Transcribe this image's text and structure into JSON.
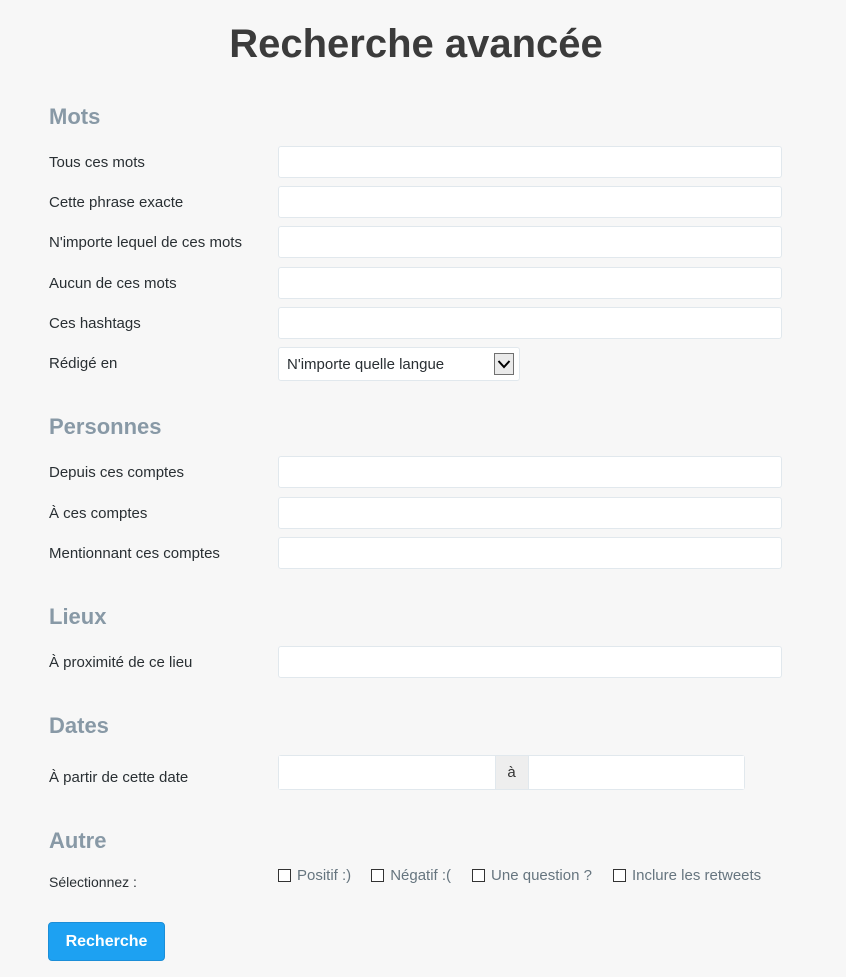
{
  "page": {
    "title": "Recherche avancée"
  },
  "words": {
    "heading": "Mots",
    "all_label": "Tous ces mots",
    "exact_label": "Cette phrase exacte",
    "any_label": "N'importe lequel de ces mots",
    "none_label": "Aucun de ces mots",
    "hashtags_label": "Ces hashtags",
    "lang_label": "Rédigé en",
    "lang_value": "N'importe quelle langue"
  },
  "people": {
    "heading": "Personnes",
    "from_label": "Depuis ces comptes",
    "to_label": "À ces comptes",
    "mention_label": "Mentionnant ces comptes"
  },
  "places": {
    "heading": "Lieux",
    "near_label": "À proximité de ce lieu"
  },
  "dates": {
    "heading": "Dates",
    "since_label": "À partir de cette date",
    "separator": "à"
  },
  "other": {
    "heading": "Autre",
    "select_label": "Sélectionnez :",
    "options": [
      "Positif :)",
      "Négatif :(",
      "Une question ?",
      "Inclure les retweets"
    ]
  },
  "submit": {
    "label": "Recherche"
  },
  "colors": {
    "button": "#1da1f2",
    "section_heading": "#8899a6"
  }
}
